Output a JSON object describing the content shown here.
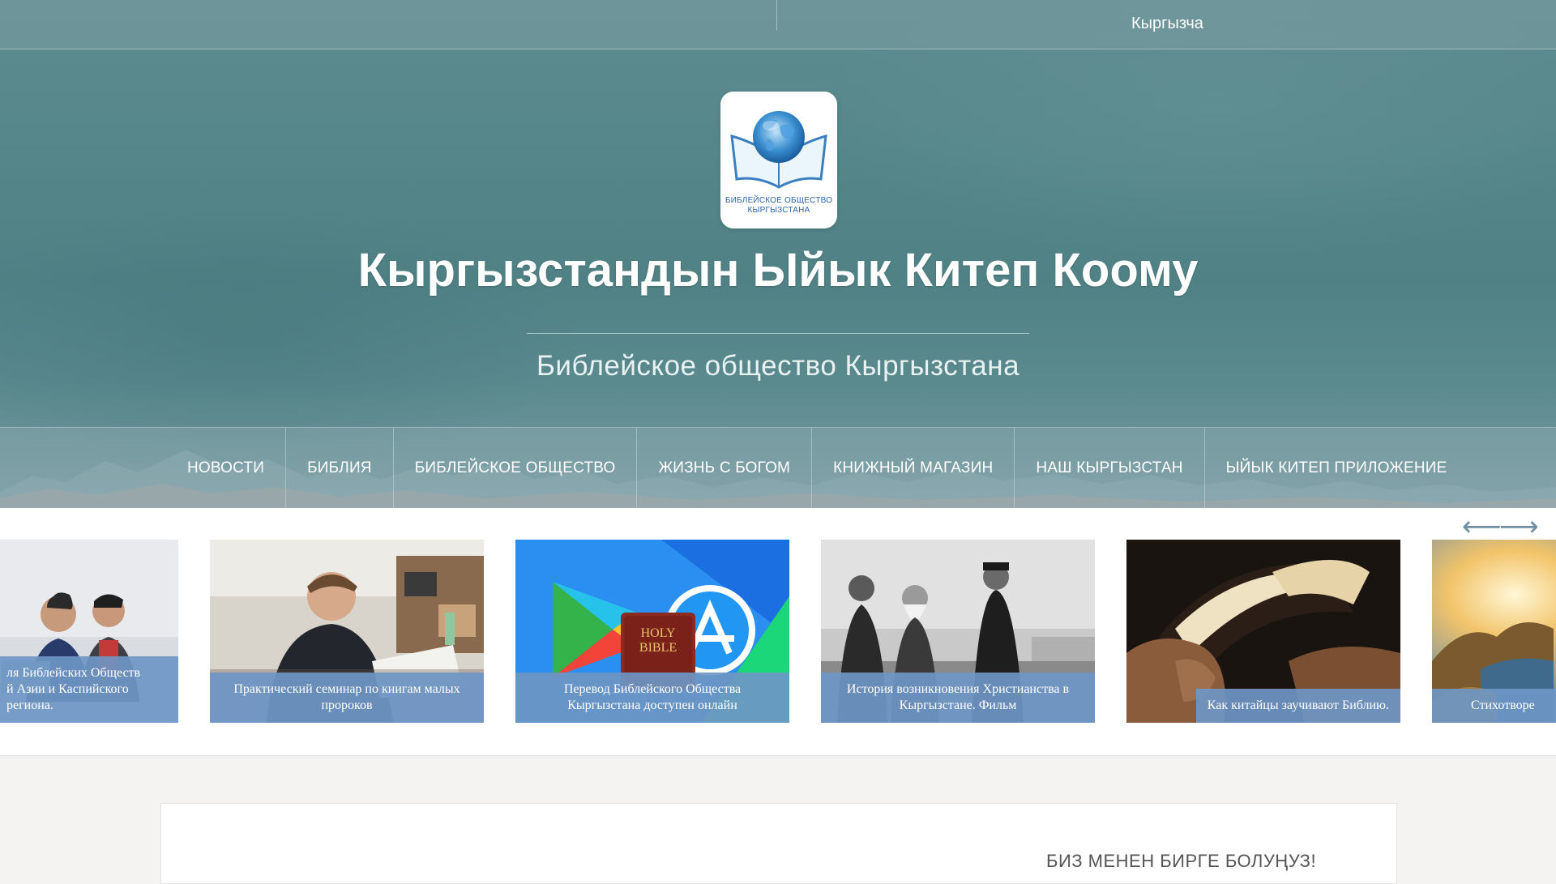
{
  "header": {
    "language_label": "Кыргызча",
    "logo_text_line1": "БИБЛЕЙСКОЕ ОБЩЕСТВО",
    "logo_text_line2": "КЫРГЫЗСТАНА",
    "site_title": "Кыргызстандын Ыйык Китеп Коому",
    "site_subtitle": "Библейское общество Кыргызстана"
  },
  "nav": {
    "items": [
      {
        "label": "НОВОСТИ"
      },
      {
        "label": "БИБЛИЯ"
      },
      {
        "label": "БИБЛЕЙСКОЕ ОБЩЕСТВО"
      },
      {
        "label": "ЖИЗНЬ С БОГОМ"
      },
      {
        "label": "КНИЖНЫЙ МАГАЗИН"
      },
      {
        "label": "НАШ КЫРГЫЗСТАН"
      },
      {
        "label": "ЫЙЫК КИТЕП ПРИЛОЖЕНИЕ"
      }
    ]
  },
  "carousel": {
    "prev_arrow": "⟵",
    "next_arrow": "⟶",
    "slides": [
      {
        "caption": "ля Библейских Обществ\nй Азии и Каспийского\nрегиона."
      },
      {
        "caption": "Практический семинар по книгам малых пророков"
      },
      {
        "caption": "Перевод Библейского Общества Кыргызстана доступен онлайн",
        "image_text_1": "HOLY",
        "image_text_2": "BIBLE"
      },
      {
        "caption": "История возникновения Христианства в Кыргызстане. Фильм"
      },
      {
        "caption": "Как китайцы заучивают Библию."
      },
      {
        "caption": "Стихотворе"
      }
    ]
  },
  "content": {
    "join_heading": "БИЗ МЕНЕН БИРГЕ БОЛУҢУЗ!"
  }
}
